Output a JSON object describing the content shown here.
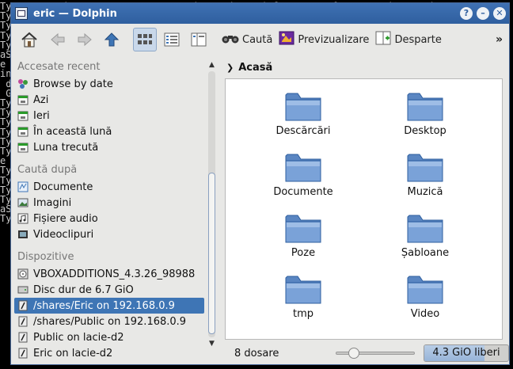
{
  "terminal": {
    "lines": [
      "Ty    Repository: parents: \"/usr/share/mime/subclasses\" refers to unknown mimetype",
      "Ty    Repository: parents: \"/usr/share/mime/subclasses\" refers to unknown mimetype",
      "Ty",
      "",
      "",
      "",
      "Ty",
      "Ty",
      "aS",
      "e",
      "in",
      "",
      "",
      "",
      "",
      " d",
      "",
      " G",
      "Ty",
      "",
      "",
      "Ty",
      "Ty",
      "Ty",
      "",
      "Ty",
      "Ty",
      "e",
      "",
      "",
      "Ty",
      "Ty",
      "Ty",
      "",
      "Ty",
      "aS",
      "Ty"
    ]
  },
  "window": {
    "title": "eric — Dolphin",
    "buttons": {
      "help": "?",
      "minimize": "–",
      "close": "✕"
    }
  },
  "toolbar": {
    "search_label": "Caută",
    "preview_label": "Previzualizare",
    "split_label": "Desparte",
    "more_label": "»"
  },
  "sidebar": {
    "recent_heading": "Accesate recent",
    "recent_items": [
      "Browse by date",
      "Azi",
      "Ieri",
      "În această lună",
      "Luna trecută"
    ],
    "search_heading": "Caută după",
    "search_items": [
      "Documente",
      "Imagini",
      "Fișiere audio",
      "Videoclipuri"
    ],
    "devices_heading": "Dispozitive",
    "device_items": [
      "VBOXADDITIONS_4.3.26_98988",
      "Disc dur de 6.7 GiO",
      "/shares/Eric on 192.168.0.9",
      "/shares/Public on 192.168.0.9",
      "Public on lacie-d2",
      "Eric on lacie-d2"
    ],
    "selected_device_index": 2
  },
  "content": {
    "breadcrumb": "Acasă",
    "folders": [
      "Descărcări",
      "Desktop",
      "Documente",
      "Muzică",
      "Poze",
      "Șabloane",
      "tmp",
      "Video"
    ]
  },
  "statusbar": {
    "count_text": "8 dosare",
    "zoom_level": 0.18,
    "free_space_label": "4.3 GiO liberi",
    "used_fraction": 0.72
  },
  "colors": {
    "titlebar": "#2f5f9f",
    "selection": "#3e75b5",
    "folder": "#6d97cf"
  }
}
